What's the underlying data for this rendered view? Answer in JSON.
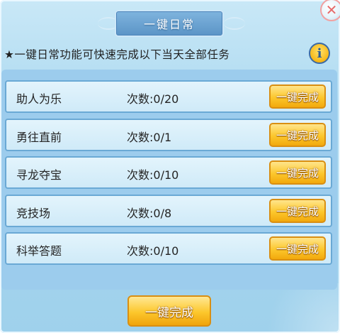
{
  "dialog": {
    "title": "一键日常",
    "hint": "★一键日常功能可快速完成以下当天全部任务",
    "info_icon_glyph": "i",
    "close_icon_glyph": "✕"
  },
  "tasks": [
    {
      "name": "助人为乐",
      "count": "次数:0/20",
      "button": "一键完成"
    },
    {
      "name": "勇往直前",
      "count": "次数:0/1",
      "button": "一键完成"
    },
    {
      "name": "寻龙夺宝",
      "count": "次数:0/10",
      "button": "一键完成"
    },
    {
      "name": "竞技场",
      "count": "次数:0/8",
      "button": "一键完成"
    },
    {
      "name": "科举答题",
      "count": "次数:0/10",
      "button": "一键完成"
    }
  ],
  "footer": {
    "complete_all_label": "一键完成"
  },
  "colors": {
    "accent_gold": "#fcc72c",
    "panel_blue": "#9ccced",
    "title_blue": "#5b94c6"
  }
}
